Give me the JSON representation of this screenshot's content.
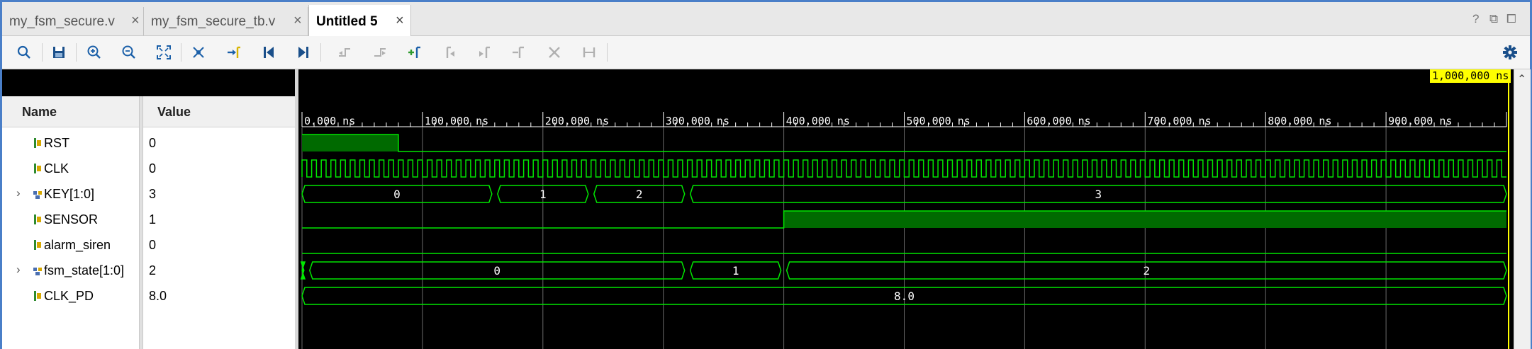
{
  "tabs": [
    {
      "label": "my_fsm_secure.v",
      "active": false
    },
    {
      "label": "my_fsm_secure_tb.v",
      "active": false
    },
    {
      "label": "Untitled 5",
      "active": true
    }
  ],
  "tab_close_glyph": "×",
  "window_controls": [
    "?",
    "⧉",
    "⧠"
  ],
  "toolbar": {
    "buttons": [
      "search-icon",
      "save-icon",
      "zoom-in-icon",
      "zoom-out-icon",
      "zoom-fit-icon",
      "marker-go-icon",
      "go-to-marker-icon",
      "go-to-start-icon",
      "go-to-end-icon",
      "previous-transition-icon",
      "next-transition-icon",
      "add-marker-icon",
      "previous-marker-icon",
      "next-marker-icon",
      "swap-cursor-icon",
      "delete-marker-icon",
      "snap-icon"
    ],
    "settings_icon": "gear-icon"
  },
  "columns": {
    "name": "Name",
    "value": "Value"
  },
  "signals": [
    {
      "name": "RST",
      "value": "0",
      "expandable": false,
      "icon": "bit-signal-icon"
    },
    {
      "name": "CLK",
      "value": "0",
      "expandable": false,
      "icon": "bit-signal-icon"
    },
    {
      "name": "KEY[1:0]",
      "value": "3",
      "expandable": true,
      "icon": "bus-signal-icon"
    },
    {
      "name": "SENSOR",
      "value": "1",
      "expandable": false,
      "icon": "bit-signal-icon"
    },
    {
      "name": "alarm_siren",
      "value": "0",
      "expandable": false,
      "icon": "bit-signal-icon"
    },
    {
      "name": "fsm_state[1:0]",
      "value": "2",
      "expandable": true,
      "icon": "bus-signal-icon"
    },
    {
      "name": "CLK_PD",
      "value": "8.0",
      "expandable": false,
      "icon": "real-signal-icon"
    }
  ],
  "expand_glyph": "›",
  "timeline": {
    "cursor_label": "1,000,000 ns",
    "tick_labels": [
      "0.000 ns",
      "100.000 ns",
      "200.000 ns",
      "300.000 ns",
      "400.000 ns",
      "500.000 ns",
      "600.000 ns",
      "700.000 ns",
      "800.000 ns",
      "900.000 ns"
    ],
    "time_range_ns": [
      0,
      1000
    ],
    "clock_period_ns": 8
  },
  "waveforms": {
    "RST": [
      {
        "t0": 0,
        "t1": 80,
        "v": 1
      },
      {
        "t0": 80,
        "t1": 1000,
        "v": 0
      }
    ],
    "SENSOR": [
      {
        "t0": 0,
        "t1": 400,
        "v": 0
      },
      {
        "t0": 400,
        "t1": 1000,
        "v": 1
      }
    ],
    "alarm_siren": [
      {
        "t0": 0,
        "t1": 1000,
        "v": 0
      }
    ],
    "KEY": [
      {
        "t0": 0,
        "t1": 160,
        "label": "0"
      },
      {
        "t0": 160,
        "t1": 240,
        "label": "1"
      },
      {
        "t0": 240,
        "t1": 320,
        "label": "2"
      },
      {
        "t0": 320,
        "t1": 1000,
        "label": "3"
      }
    ],
    "fsm_state": [
      {
        "t0": 0,
        "t1": 4,
        "label": ""
      },
      {
        "t0": 4,
        "t1": 320,
        "label": "0"
      },
      {
        "t0": 320,
        "t1": 400,
        "label": "1"
      },
      {
        "t0": 400,
        "t1": 1000,
        "label": "2"
      }
    ],
    "CLK_PD": [
      {
        "t0": 0,
        "t1": 1000,
        "label": "8.0"
      }
    ]
  },
  "colors": {
    "wave": "#00e600",
    "wave_fill": "#006a00",
    "grid": "#6a6a6a",
    "cursor": "#ffff00",
    "tab_border": "#4a7fc8"
  }
}
